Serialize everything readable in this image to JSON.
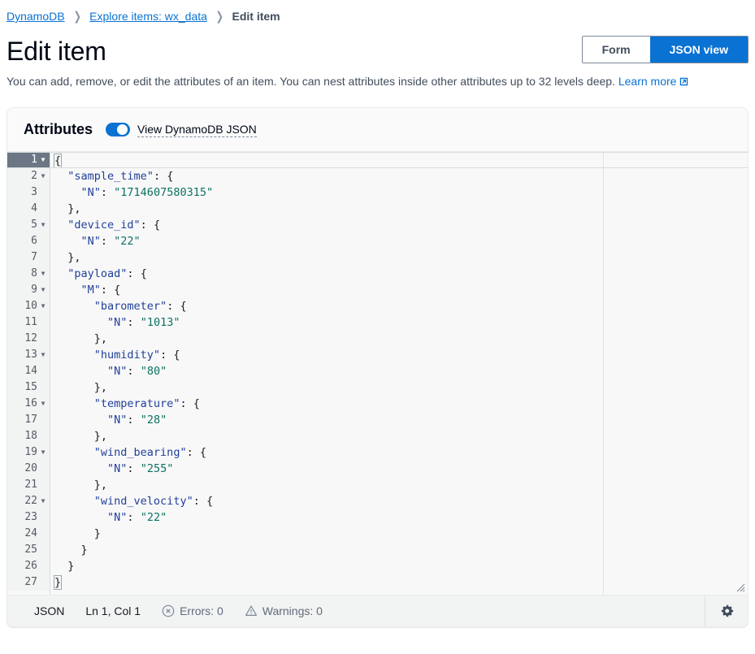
{
  "breadcrumb": {
    "items": [
      {
        "label": "DynamoDB",
        "type": "link"
      },
      {
        "label": "Explore items: wx_data",
        "type": "link"
      },
      {
        "label": "Edit item",
        "type": "current"
      }
    ],
    "separator": "❯"
  },
  "header": {
    "title": "Edit item",
    "view_toggle": {
      "form_label": "Form",
      "json_label": "JSON view",
      "selected": "JSON view"
    }
  },
  "description": {
    "text": "You can add, remove, or edit the attributes of an item. You can nest attributes inside other attributes up to 32 levels deep.",
    "link_label": "Learn more",
    "external_icon": "external-link-icon"
  },
  "attributes_panel": {
    "title": "Attributes",
    "toggle": {
      "label": "View DynamoDB JSON",
      "enabled": true
    }
  },
  "editor": {
    "language": "JSON",
    "lines": [
      {
        "n": 1,
        "fold": true,
        "indent": 0,
        "tokens": [
          {
            "t": "{",
            "c": "p",
            "box": true
          }
        ]
      },
      {
        "n": 2,
        "fold": true,
        "indent": 1,
        "tokens": [
          {
            "t": "\"sample_time\"",
            "c": "k"
          },
          {
            "t": ": ",
            "c": "p"
          },
          {
            "t": "{",
            "c": "p"
          }
        ]
      },
      {
        "n": 3,
        "fold": false,
        "indent": 2,
        "tokens": [
          {
            "t": "\"N\"",
            "c": "k"
          },
          {
            "t": ": ",
            "c": "p"
          },
          {
            "t": "\"1714607580315\"",
            "c": "s"
          }
        ]
      },
      {
        "n": 4,
        "fold": false,
        "indent": 1,
        "tokens": [
          {
            "t": "},",
            "c": "p"
          }
        ]
      },
      {
        "n": 5,
        "fold": true,
        "indent": 1,
        "tokens": [
          {
            "t": "\"device_id\"",
            "c": "k"
          },
          {
            "t": ": ",
            "c": "p"
          },
          {
            "t": "{",
            "c": "p"
          }
        ]
      },
      {
        "n": 6,
        "fold": false,
        "indent": 2,
        "tokens": [
          {
            "t": "\"N\"",
            "c": "k"
          },
          {
            "t": ": ",
            "c": "p"
          },
          {
            "t": "\"22\"",
            "c": "s"
          }
        ]
      },
      {
        "n": 7,
        "fold": false,
        "indent": 1,
        "tokens": [
          {
            "t": "},",
            "c": "p"
          }
        ]
      },
      {
        "n": 8,
        "fold": true,
        "indent": 1,
        "tokens": [
          {
            "t": "\"payload\"",
            "c": "k"
          },
          {
            "t": ": ",
            "c": "p"
          },
          {
            "t": "{",
            "c": "p"
          }
        ]
      },
      {
        "n": 9,
        "fold": true,
        "indent": 2,
        "tokens": [
          {
            "t": "\"M\"",
            "c": "k"
          },
          {
            "t": ": ",
            "c": "p"
          },
          {
            "t": "{",
            "c": "p"
          }
        ]
      },
      {
        "n": 10,
        "fold": true,
        "indent": 3,
        "tokens": [
          {
            "t": "\"barometer\"",
            "c": "k"
          },
          {
            "t": ": ",
            "c": "p"
          },
          {
            "t": "{",
            "c": "p"
          }
        ]
      },
      {
        "n": 11,
        "fold": false,
        "indent": 4,
        "tokens": [
          {
            "t": "\"N\"",
            "c": "k"
          },
          {
            "t": ": ",
            "c": "p"
          },
          {
            "t": "\"1013\"",
            "c": "s"
          }
        ]
      },
      {
        "n": 12,
        "fold": false,
        "indent": 3,
        "tokens": [
          {
            "t": "},",
            "c": "p"
          }
        ]
      },
      {
        "n": 13,
        "fold": true,
        "indent": 3,
        "tokens": [
          {
            "t": "\"humidity\"",
            "c": "k"
          },
          {
            "t": ": ",
            "c": "p"
          },
          {
            "t": "{",
            "c": "p"
          }
        ]
      },
      {
        "n": 14,
        "fold": false,
        "indent": 4,
        "tokens": [
          {
            "t": "\"N\"",
            "c": "k"
          },
          {
            "t": ": ",
            "c": "p"
          },
          {
            "t": "\"80\"",
            "c": "s"
          }
        ]
      },
      {
        "n": 15,
        "fold": false,
        "indent": 3,
        "tokens": [
          {
            "t": "},",
            "c": "p"
          }
        ]
      },
      {
        "n": 16,
        "fold": true,
        "indent": 3,
        "tokens": [
          {
            "t": "\"temperature\"",
            "c": "k"
          },
          {
            "t": ": ",
            "c": "p"
          },
          {
            "t": "{",
            "c": "p"
          }
        ]
      },
      {
        "n": 17,
        "fold": false,
        "indent": 4,
        "tokens": [
          {
            "t": "\"N\"",
            "c": "k"
          },
          {
            "t": ": ",
            "c": "p"
          },
          {
            "t": "\"28\"",
            "c": "s"
          }
        ]
      },
      {
        "n": 18,
        "fold": false,
        "indent": 3,
        "tokens": [
          {
            "t": "},",
            "c": "p"
          }
        ]
      },
      {
        "n": 19,
        "fold": true,
        "indent": 3,
        "tokens": [
          {
            "t": "\"wind_bearing\"",
            "c": "k"
          },
          {
            "t": ": ",
            "c": "p"
          },
          {
            "t": "{",
            "c": "p"
          }
        ]
      },
      {
        "n": 20,
        "fold": false,
        "indent": 4,
        "tokens": [
          {
            "t": "\"N\"",
            "c": "k"
          },
          {
            "t": ": ",
            "c": "p"
          },
          {
            "t": "\"255\"",
            "c": "s"
          }
        ]
      },
      {
        "n": 21,
        "fold": false,
        "indent": 3,
        "tokens": [
          {
            "t": "},",
            "c": "p"
          }
        ]
      },
      {
        "n": 22,
        "fold": true,
        "indent": 3,
        "tokens": [
          {
            "t": "\"wind_velocity\"",
            "c": "k"
          },
          {
            "t": ": ",
            "c": "p"
          },
          {
            "t": "{",
            "c": "p"
          }
        ]
      },
      {
        "n": 23,
        "fold": false,
        "indent": 4,
        "tokens": [
          {
            "t": "\"N\"",
            "c": "k"
          },
          {
            "t": ": ",
            "c": "p"
          },
          {
            "t": "\"22\"",
            "c": "s"
          }
        ]
      },
      {
        "n": 24,
        "fold": false,
        "indent": 3,
        "tokens": [
          {
            "t": "}",
            "c": "p"
          }
        ]
      },
      {
        "n": 25,
        "fold": false,
        "indent": 2,
        "tokens": [
          {
            "t": "}",
            "c": "p"
          }
        ]
      },
      {
        "n": 26,
        "fold": false,
        "indent": 1,
        "tokens": [
          {
            "t": "}",
            "c": "p"
          }
        ]
      },
      {
        "n": 27,
        "fold": false,
        "indent": 0,
        "tokens": [
          {
            "t": "}",
            "c": "p",
            "box": true
          }
        ]
      }
    ],
    "active_line": 1
  },
  "statusbar": {
    "language": "JSON",
    "cursor": "Ln 1, Col 1",
    "errors_label": "Errors: 0",
    "warnings_label": "Warnings: 0",
    "errors_icon": "error-circle-icon",
    "warnings_icon": "warning-triangle-icon",
    "settings_icon": "gear-icon"
  },
  "colors": {
    "accent_blue": "#0972d3",
    "link_blue": "#0972d3",
    "json_key": "#21409a",
    "json_string": "#0b7261",
    "active_gutter": "#6b7785",
    "gutter_bg": "#f2f3f3",
    "editor_bg": "#f8f8f8"
  }
}
